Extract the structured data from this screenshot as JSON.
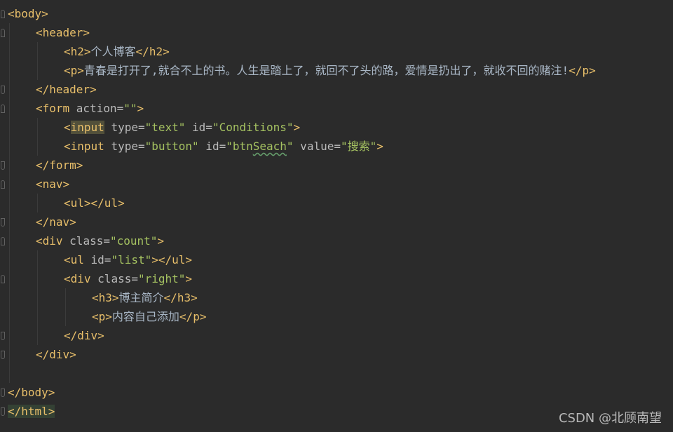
{
  "editor": {
    "lines": [
      {
        "indent": 0,
        "tokens": [
          {
            "t": "tag",
            "v": "<body>"
          }
        ]
      },
      {
        "indent": 1,
        "tokens": [
          {
            "t": "tag",
            "v": "<header>"
          }
        ]
      },
      {
        "indent": 2,
        "tokens": [
          {
            "t": "tag",
            "v": "<h2>"
          },
          {
            "t": "txt",
            "v": "个人博客"
          },
          {
            "t": "tag",
            "v": "</h2>"
          }
        ]
      },
      {
        "indent": 2,
        "tokens": [
          {
            "t": "tag",
            "v": "<p>"
          },
          {
            "t": "txt",
            "v": "青春是打开了,就合不上的书。人生是踏上了，就回不了头的路，爱情是扔出了，就收不回的赌注!"
          },
          {
            "t": "tag",
            "v": "</p>"
          }
        ]
      },
      {
        "indent": 1,
        "tokens": [
          {
            "t": "tag",
            "v": "</header>"
          }
        ]
      },
      {
        "indent": 1,
        "tokens": [
          {
            "t": "tag",
            "v": "<form "
          },
          {
            "t": "attr",
            "v": "action="
          },
          {
            "t": "val",
            "v": "\"\""
          },
          {
            "t": "tag",
            "v": ">"
          }
        ]
      },
      {
        "indent": 2,
        "tokens": [
          {
            "t": "tag",
            "v": "<"
          },
          {
            "t": "tag hl",
            "v": "input"
          },
          {
            "t": "attr",
            "v": " type="
          },
          {
            "t": "val",
            "v": "\"text\""
          },
          {
            "t": "attr",
            "v": " id="
          },
          {
            "t": "val",
            "v": "\"Conditions\""
          },
          {
            "t": "tag",
            "v": ">"
          }
        ]
      },
      {
        "indent": 2,
        "tokens": [
          {
            "t": "tag",
            "v": "<input "
          },
          {
            "t": "attr",
            "v": "type="
          },
          {
            "t": "val",
            "v": "\"button\""
          },
          {
            "t": "attr",
            "v": " id="
          },
          {
            "t": "val",
            "v": "\"btn"
          },
          {
            "t": "val squiggle",
            "v": "Seach"
          },
          {
            "t": "val",
            "v": "\""
          },
          {
            "t": "attr",
            "v": " value="
          },
          {
            "t": "val",
            "v": "\"搜索\""
          },
          {
            "t": "tag",
            "v": ">"
          }
        ]
      },
      {
        "indent": 1,
        "tokens": [
          {
            "t": "tag",
            "v": "</form>"
          }
        ]
      },
      {
        "indent": 1,
        "tokens": [
          {
            "t": "tag",
            "v": "<nav>"
          }
        ]
      },
      {
        "indent": 2,
        "tokens": [
          {
            "t": "tag",
            "v": "<ul></ul>"
          }
        ]
      },
      {
        "indent": 1,
        "tokens": [
          {
            "t": "tag",
            "v": "</nav>"
          }
        ]
      },
      {
        "indent": 1,
        "tokens": [
          {
            "t": "tag",
            "v": "<div "
          },
          {
            "t": "attr",
            "v": "class="
          },
          {
            "t": "val",
            "v": "\"count\""
          },
          {
            "t": "tag",
            "v": ">"
          }
        ]
      },
      {
        "indent": 2,
        "tokens": [
          {
            "t": "tag",
            "v": "<ul "
          },
          {
            "t": "attr",
            "v": "id="
          },
          {
            "t": "val",
            "v": "\"list\""
          },
          {
            "t": "tag",
            "v": "></ul>"
          }
        ]
      },
      {
        "indent": 2,
        "tokens": [
          {
            "t": "tag",
            "v": "<div "
          },
          {
            "t": "attr",
            "v": "class="
          },
          {
            "t": "val",
            "v": "\"right\""
          },
          {
            "t": "tag",
            "v": ">"
          }
        ]
      },
      {
        "indent": 3,
        "tokens": [
          {
            "t": "tag",
            "v": "<h3>"
          },
          {
            "t": "txt",
            "v": "博主简介"
          },
          {
            "t": "tag",
            "v": "</h3>"
          }
        ]
      },
      {
        "indent": 3,
        "tokens": [
          {
            "t": "tag",
            "v": "<p>"
          },
          {
            "t": "txt",
            "v": "内容自己添加"
          },
          {
            "t": "tag",
            "v": "</p>"
          }
        ]
      },
      {
        "indent": 2,
        "tokens": [
          {
            "t": "tag",
            "v": "</div>"
          }
        ]
      },
      {
        "indent": 1,
        "tokens": [
          {
            "t": "tag",
            "v": "</div>"
          }
        ]
      },
      {
        "indent": 0,
        "tokens": []
      },
      {
        "indent": 0,
        "tokens": [
          {
            "t": "tag",
            "v": "</body>"
          }
        ]
      },
      {
        "indent": 0,
        "tokens": [
          {
            "t": "tag caretline",
            "v": "</html>"
          }
        ]
      }
    ],
    "fold_markers": [
      {
        "line": 0,
        "dir": "down"
      },
      {
        "line": 1,
        "dir": "down"
      },
      {
        "line": 4,
        "dir": "up"
      },
      {
        "line": 5,
        "dir": "down"
      },
      {
        "line": 8,
        "dir": "up"
      },
      {
        "line": 9,
        "dir": "down"
      },
      {
        "line": 11,
        "dir": "up"
      },
      {
        "line": 12,
        "dir": "down"
      },
      {
        "line": 14,
        "dir": "down"
      },
      {
        "line": 17,
        "dir": "up"
      },
      {
        "line": 18,
        "dir": "up"
      },
      {
        "line": 20,
        "dir": "up"
      },
      {
        "line": 21,
        "dir": "up"
      }
    ],
    "colors": {
      "background": "#2b2b2b",
      "tag": "#e8bf6a",
      "attribute": "#bababa",
      "string": "#a5c261",
      "text": "#a9b7c6"
    }
  },
  "watermark": "CSDN @北顾南望"
}
